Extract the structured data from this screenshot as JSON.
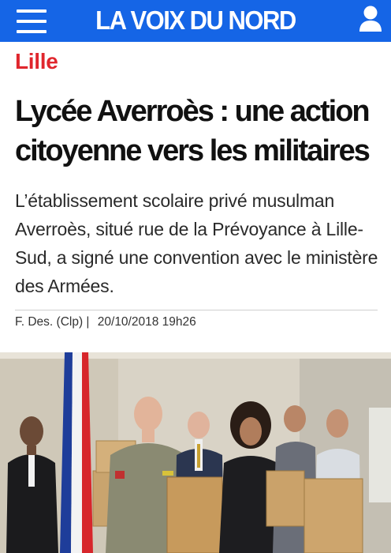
{
  "header": {
    "brand": "LA VOIX DU NORD",
    "menu_icon": "hamburger-menu-icon",
    "user_icon": "user-account-icon",
    "background_color": "#1565e6"
  },
  "article": {
    "section": "Lille",
    "section_color": "#e0262d",
    "title": "Lycée Averroès : une action citoyenne vers les militaires",
    "lead": "L’établissement scolaire privé musulman Averroès, situé rue de la Prévoyance à Lille-Sud, a signé une convention avec le ministère des Armées.",
    "byline": {
      "author": "F. Des. (Clp) |",
      "date": "20/10/2018 19h26"
    }
  }
}
